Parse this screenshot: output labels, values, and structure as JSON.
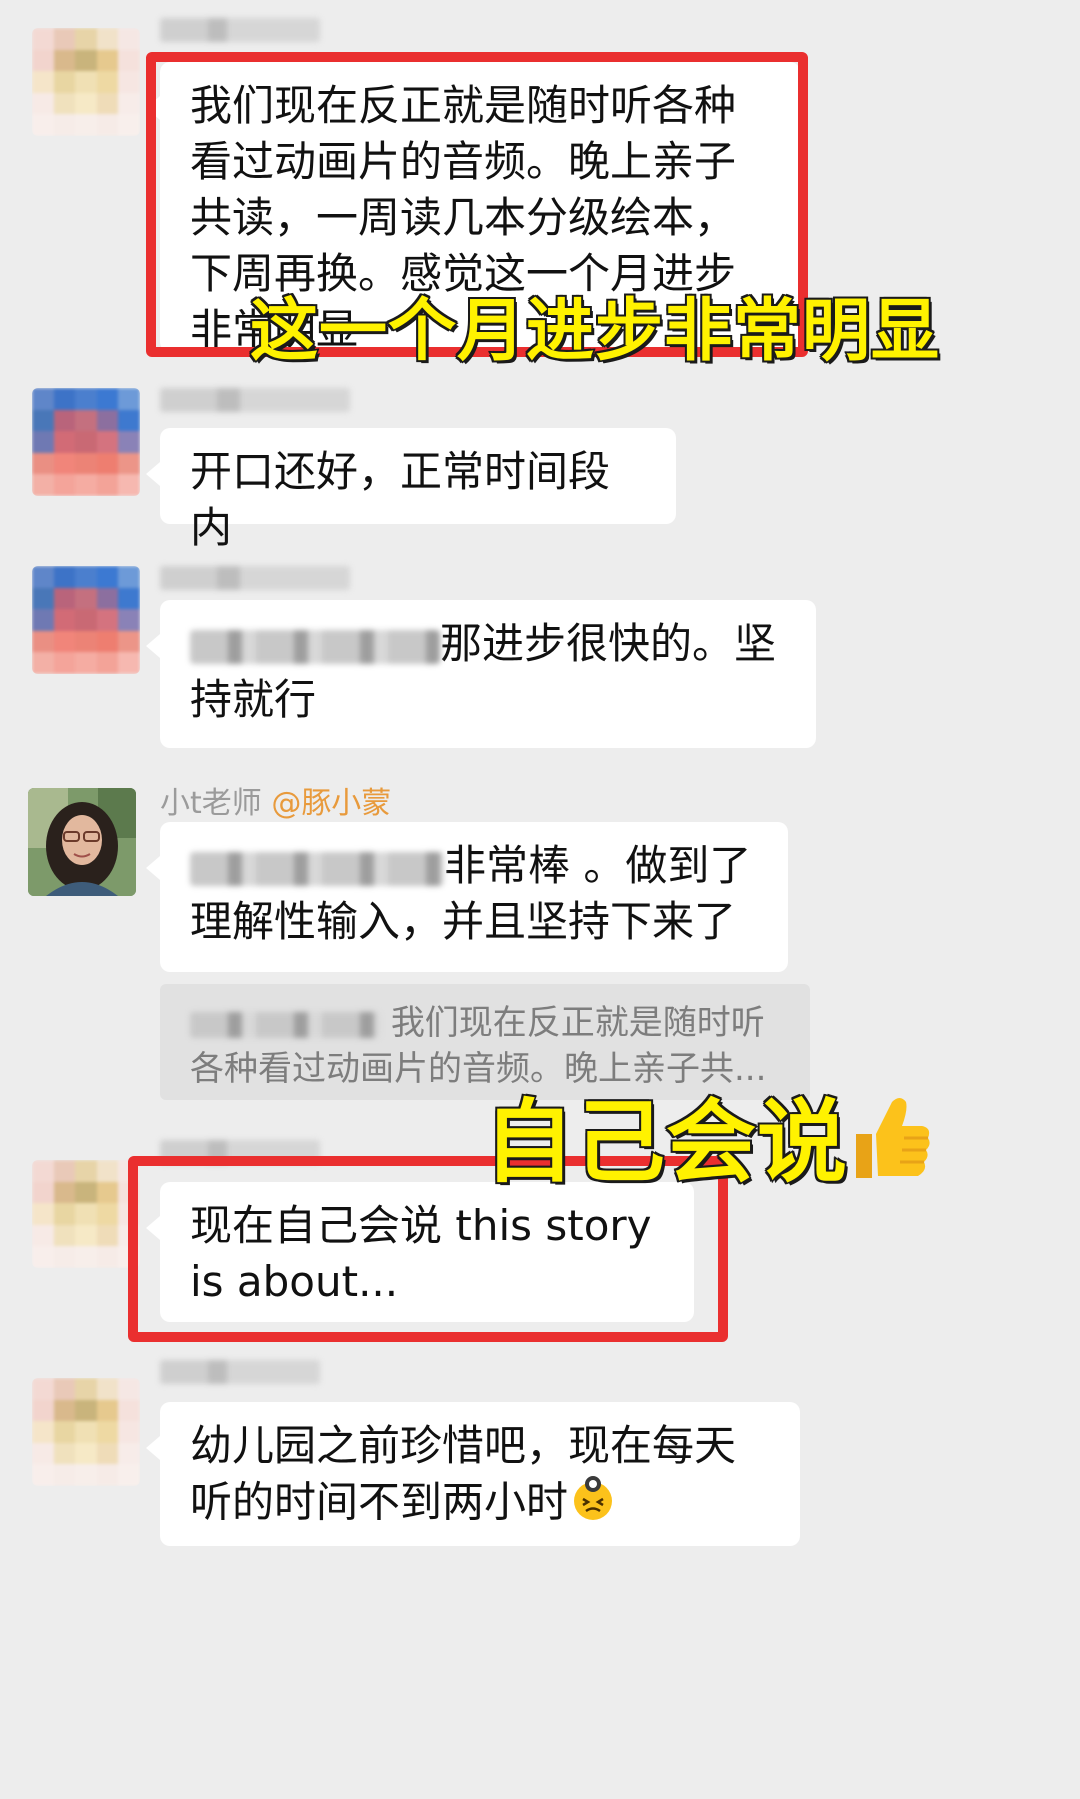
{
  "messages": [
    {
      "text": "我们现在反正就是随时听各种看过动画片的音频。晚上亲子共读，一周读几本分级绘本，下周再换。感觉这一个月进步非常明显"
    },
    {
      "text": "开口还好，正常时间段内"
    },
    {
      "text": "那进步很快的。坚持就行"
    },
    {
      "sender": "小t老师",
      "mention": "@豚小蒙",
      "text_a": "非常棒 。做到了",
      "text_b": "理解性输入，并且坚持下来了",
      "quote": "我们现在反正就是随时听各种看过动画片的音频。晚上亲子共..."
    },
    {
      "text": "现在自己会说 this story is about..."
    },
    {
      "text": "幼儿园之前珍惜吧，现在每天听的时间不到两小时"
    }
  ],
  "captions": {
    "caption1": "这一个月进步非常明显",
    "caption2": "自己会说"
  },
  "icons": {
    "thumbs_up": "thumbs-up-emoji",
    "sweat": "frustrated-emoji"
  },
  "colors": {
    "highlight_box": "#ea2f2f",
    "caption_fill": "#fff200",
    "mention": "#e89a3c",
    "background": "#ededed"
  }
}
